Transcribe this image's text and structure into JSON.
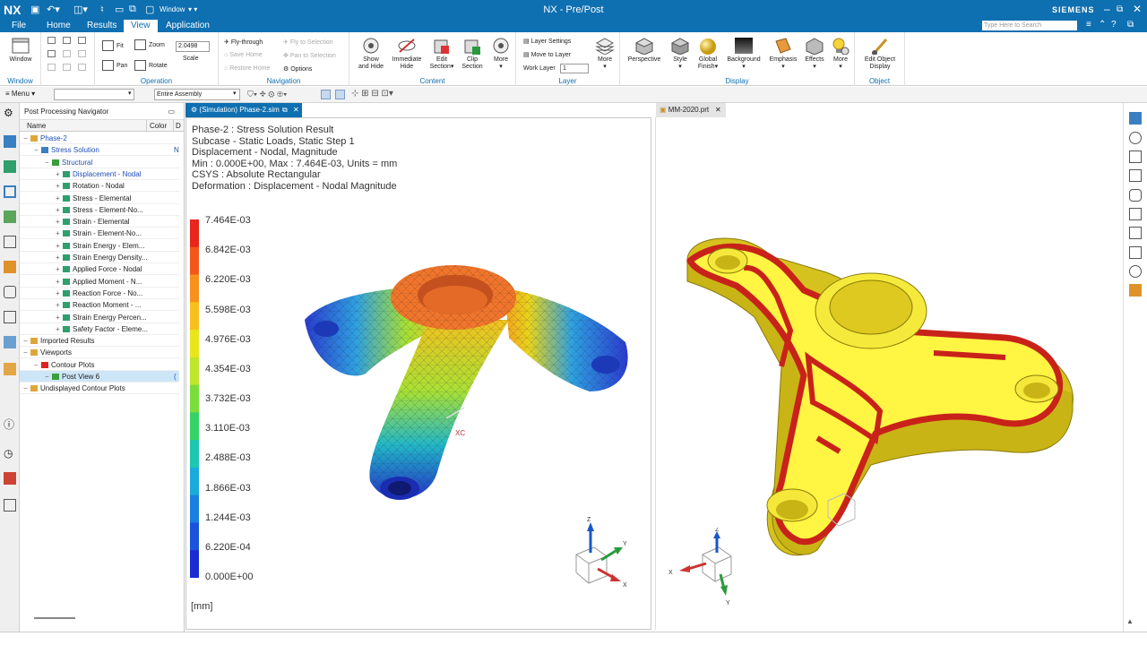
{
  "app": {
    "logo": "NX",
    "title": "NX - Pre/Post",
    "brand": "SIEMENS",
    "window_menu": "Window",
    "search_placeholder": "Type Here to Search"
  },
  "menu": {
    "items": [
      "File",
      "Home",
      "Results",
      "View",
      "Application"
    ],
    "active": "View"
  },
  "ribbon": {
    "groups": {
      "window": "Window",
      "operation": "Operation",
      "navigation": "Navigation",
      "content": "Content",
      "layer": "Layer",
      "display": "Display",
      "object": "Object"
    },
    "window_btn": "Window",
    "fit": "Fit",
    "pan": "Pan",
    "zoom": "Zoom",
    "rotate": "Rotate",
    "scale_value": "2.0498",
    "scale_label": "Scale",
    "fly_through": "Fly-through",
    "save_home": "Save Home",
    "restore_home": "Restore Home",
    "fly_to_selection": "Fly to Selection",
    "pan_to_selection": "Pan to Selection",
    "options": "Options",
    "show_hide": [
      "Show",
      "and Hide"
    ],
    "immediate_hide": [
      "Immediate",
      "Hide"
    ],
    "edit_section": [
      "Edit",
      "Section"
    ],
    "clip_section": [
      "Clip",
      "Section"
    ],
    "more": "More",
    "layer_settings": "Layer Settings",
    "move_to_layer": "Move to Layer",
    "work_layer": "Work Layer",
    "work_layer_value": "1",
    "perspective": "Perspective",
    "style": "Style",
    "global_finish": [
      "Global",
      "Finish"
    ],
    "background": "Background",
    "emphasis": "Emphasis",
    "effects": "Effects",
    "edit_object_display": [
      "Edit Object",
      "Display"
    ]
  },
  "toolbar2": {
    "menu": "Menu",
    "filter_value": "",
    "assembly_value": "Entire Assembly"
  },
  "navigator": {
    "title": "Post Processing Navigator",
    "col_name": "Name",
    "col_color": "Color",
    "col_d": "D",
    "rows": [
      {
        "label": "Phase-2",
        "level": 0,
        "blue": true
      },
      {
        "label": "Stress Solution",
        "level": 1,
        "blue": true,
        "extra": "N"
      },
      {
        "label": "Structural",
        "level": 2,
        "blue": true
      },
      {
        "label": "Displacement - Nodal",
        "level": 3,
        "blue": true
      },
      {
        "label": "Rotation - Nodal",
        "level": 3
      },
      {
        "label": "Stress - Elemental",
        "level": 3
      },
      {
        "label": "Stress - Element-No...",
        "level": 3
      },
      {
        "label": "Strain - Elemental",
        "level": 3
      },
      {
        "label": "Strain - Element-No...",
        "level": 3
      },
      {
        "label": "Strain Energy - Elem...",
        "level": 3
      },
      {
        "label": "Strain Energy Density...",
        "level": 3
      },
      {
        "label": "Applied Force - Nodal",
        "level": 3
      },
      {
        "label": "Applied Moment - N...",
        "level": 3
      },
      {
        "label": "Reaction Force - No...",
        "level": 3
      },
      {
        "label": "Reaction Moment - ...",
        "level": 3
      },
      {
        "label": "Strain Energy Percen...",
        "level": 3
      },
      {
        "label": "Safety Factor - Eleme...",
        "level": 3
      },
      {
        "label": "Imported Results",
        "level": 0
      },
      {
        "label": "Viewports",
        "level": 0
      },
      {
        "label": "Contour Plots",
        "level": 1
      },
      {
        "label": "Post View 6",
        "level": 2,
        "selected": true,
        "extra": "("
      },
      {
        "label": "Undisplayed Contour Plots",
        "level": 0
      }
    ]
  },
  "viewport1": {
    "tab": "(Simulation) Phase-2.sim",
    "info": [
      "Phase-2 : Stress Solution Result",
      "Subcase - Static Loads, Static Step 1",
      "Displacement - Nodal, Magnitude",
      "Min : 0.000E+00, Max : 7.464E-03, Units = mm",
      "CSYS : Absolute Rectangular",
      "Deformation : Displacement - Nodal Magnitude"
    ],
    "legend_values": [
      "7.464E-03",
      "6.842E-03",
      "6.220E-03",
      "5.598E-03",
      "4.976E-03",
      "4.354E-03",
      "3.732E-03",
      "3.110E-03",
      "2.488E-03",
      "1.866E-03",
      "1.244E-03",
      "6.220E-04",
      "0.000E+00"
    ],
    "legend_colors": [
      "#e8261c",
      "#f2581a",
      "#f8901e",
      "#f7c01c",
      "#e9e51d",
      "#bde62c",
      "#7bdd3b",
      "#35d267",
      "#1cc8b0",
      "#1ca9dc",
      "#1b7fe0",
      "#1a52dc",
      "#1a2bd4"
    ],
    "unit": "[mm]",
    "csys_label": "XC",
    "triad": {
      "x": "X",
      "y": "Y",
      "z": "Z"
    }
  },
  "viewport2": {
    "tab": "MM-2020.prt",
    "triad": {
      "x": "X",
      "y": "Y",
      "z": "Z"
    }
  }
}
